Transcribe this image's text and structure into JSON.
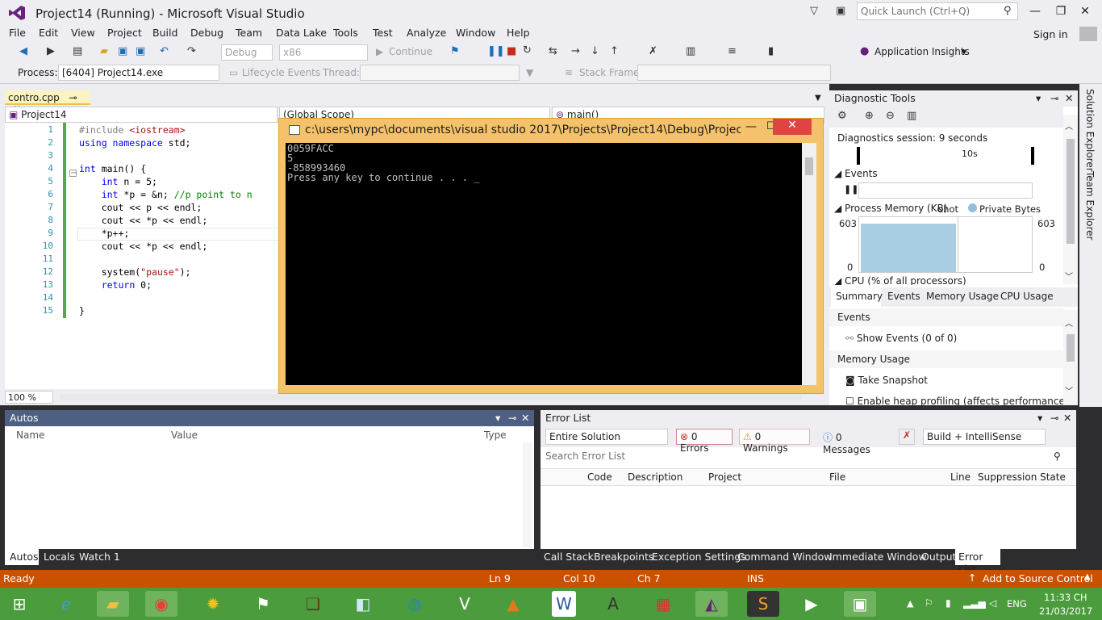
{
  "window": {
    "title": "Project14 (Running) - Microsoft Visual Studio",
    "quick_launch_placeholder": "Quick Launch (Ctrl+Q)",
    "sign_in": "Sign in"
  },
  "menu": [
    "File",
    "Edit",
    "View",
    "Project",
    "Build",
    "Debug",
    "Team",
    "Data Lake",
    "Tools",
    "Test",
    "Analyze",
    "Window",
    "Help"
  ],
  "toolbar": {
    "config": "Debug",
    "platform": "x86",
    "continue": "Continue",
    "app_insights": "Application Insights"
  },
  "toolbar2": {
    "process_label": "Process:",
    "process_value": "[6404] Project14.exe",
    "lifecycle": "Lifecycle Events",
    "thread_label": "Thread:",
    "stack_label": "Stack Frame:"
  },
  "editor": {
    "tab": "contro.cpp",
    "project_combo": "Project14",
    "scope_combo": "(Global Scope)",
    "func_combo": "main()",
    "zoom": "100 %",
    "line_numbers": [
      "1",
      "2",
      "3",
      "4",
      "5",
      "6",
      "7",
      "8",
      "9",
      "10",
      "11",
      "12",
      "13",
      "14",
      "15"
    ]
  },
  "console": {
    "title": "c:\\users\\mypc\\documents\\visual studio 2017\\Projects\\Project14\\Debug\\Project...",
    "lines": [
      "0059FACC",
      "5",
      "-858993460",
      "Press any key to continue . . . _"
    ]
  },
  "diagnostics": {
    "title": "Diagnostic Tools",
    "session": "Diagnostics session: 9 seconds",
    "timeline_label": "10s",
    "events_header": "Events",
    "memory_header": "Process Memory (KB)",
    "snapshot": "Snapshot",
    "private_bytes": "Private Bytes",
    "mem_max": "603",
    "mem_min": "0",
    "cpu_header": "CPU (% of all processors)",
    "tabs": [
      "Summary",
      "Events",
      "Memory Usage",
      "CPU Usage"
    ],
    "events_section": "Events",
    "show_events": "Show Events (0 of 0)",
    "memory_section": "Memory Usage",
    "take_snapshot": "Take Snapshot",
    "enable_heap": "Enable heap profiling (affects performance)"
  },
  "rightrail": [
    "Solution Explorer",
    "Team Explorer"
  ],
  "autos": {
    "title": "Autos",
    "columns": [
      "Name",
      "Value",
      "Type"
    ],
    "tabs": [
      "Autos",
      "Locals",
      "Watch 1"
    ]
  },
  "errors": {
    "title": "Error List",
    "scope": "Entire Solution",
    "errors": "0 Errors",
    "warnings": "0 Warnings",
    "messages": "0 Messages",
    "build": "Build + IntelliSense",
    "search_placeholder": "Search Error List",
    "columns": [
      "Code",
      "Description",
      "Project",
      "File",
      "Line",
      "Suppression State"
    ],
    "tabs": [
      "Call Stack",
      "Breakpoints",
      "Exception Settings",
      "Command Window",
      "Immediate Window",
      "Output",
      "Error List"
    ]
  },
  "status": {
    "ready": "Ready",
    "ln": "Ln 9",
    "col": "Col 10",
    "ch": "Ch 7",
    "ins": "INS",
    "source_control": "Add to Source Control"
  },
  "taskbar": {
    "lang": "ENG",
    "time": "11:33 CH",
    "date": "21/03/2017"
  },
  "colors": {
    "accent": "#ca5100",
    "console_title": "#f4c26a",
    "taskbar": "#4b9c3c"
  }
}
